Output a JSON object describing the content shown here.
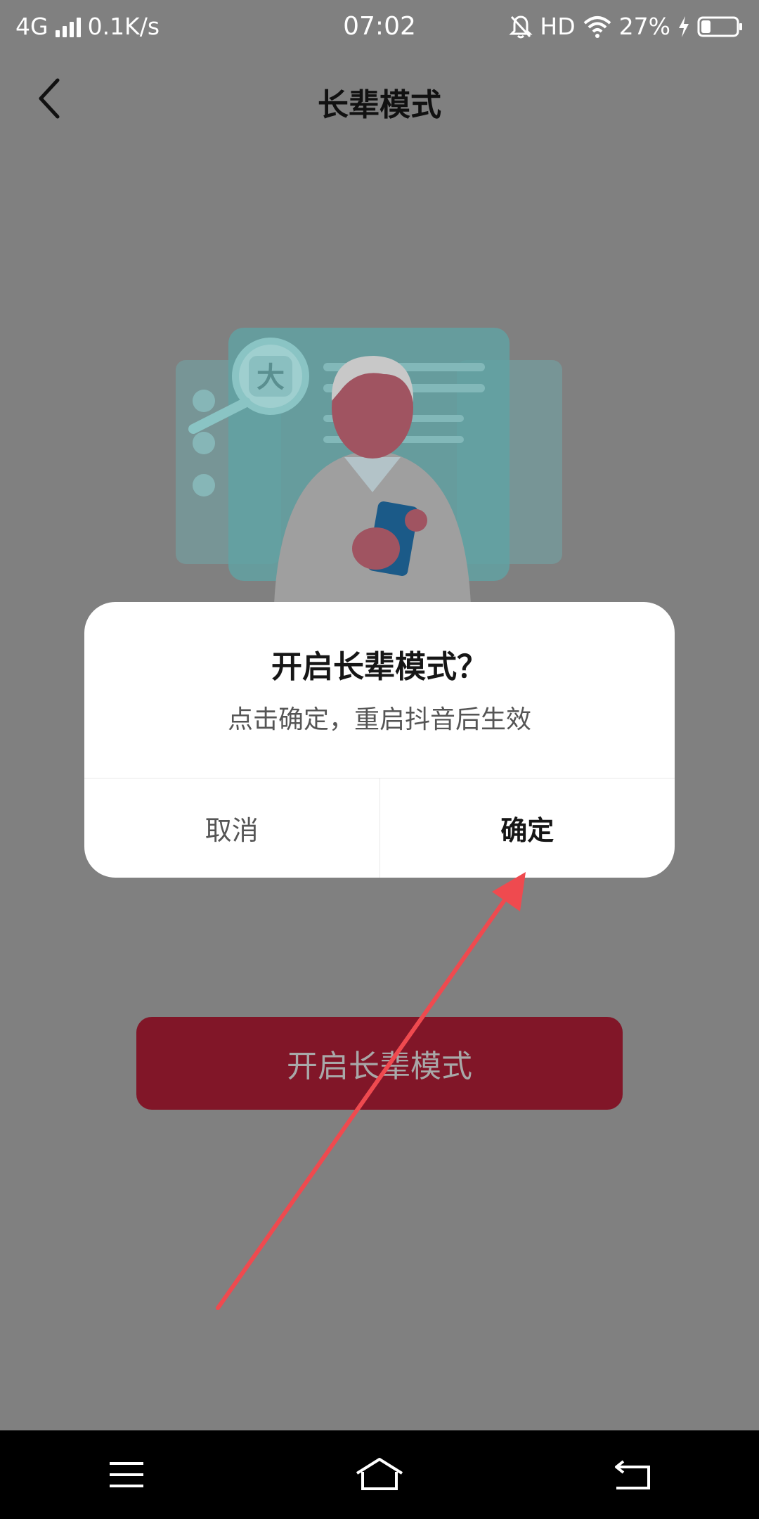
{
  "status_bar": {
    "network": "4G",
    "speed": "0.1K/s",
    "time": "07:02",
    "hd": "HD",
    "battery": "27%",
    "battery_level": 0.27
  },
  "header": {
    "title": "长辈模式"
  },
  "main": {
    "enable_button_label": "开启长辈模式",
    "illustration_magnifier_char": "大"
  },
  "dialog": {
    "title": "开启长辈模式？",
    "message": "点击确定，重启抖音后生效",
    "cancel_label": "取消",
    "confirm_label": "确定"
  },
  "colors": {
    "overlay_bg": "#808080",
    "primary_dimmed": "#811628",
    "annotation_arrow": "#ef4a4f"
  },
  "icons": {
    "back": "chevron-left-icon",
    "menu": "menu-icon",
    "home": "home-icon",
    "return": "back-icon"
  }
}
